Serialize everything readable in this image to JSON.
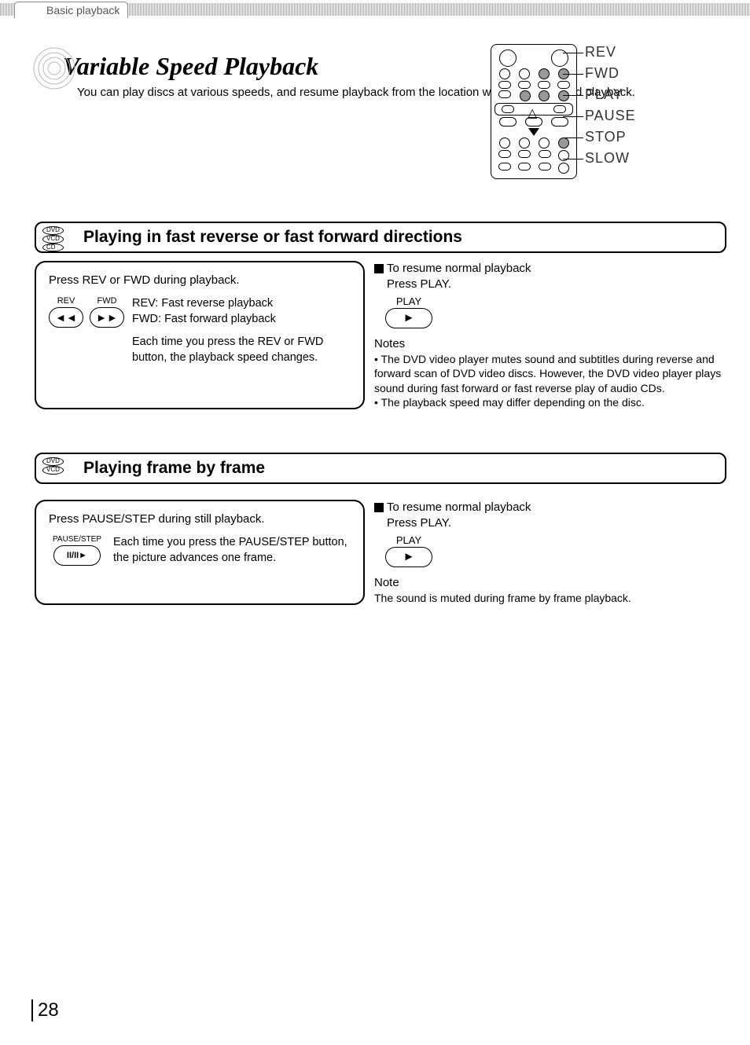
{
  "tab": "Basic playback",
  "title": "Variable Speed Playback",
  "intro": "You can play discs at various speeds, and resume playback from the location where you stopped playback.",
  "remote_labels": [
    "REV",
    "FWD",
    "PLAY",
    "PAUSE",
    "STOP",
    "SLOW"
  ],
  "section1": {
    "discs": [
      "DVD",
      "VCD",
      "CD"
    ],
    "heading": "Playing in fast reverse or fast forward directions",
    "lead": "Press REV or FWD during playback.",
    "btn_rev": "REV",
    "btn_fwd": "FWD",
    "desc1": "REV: Fast reverse playback\nFWD: Fast forward playback",
    "desc2": "Each time you press the REV or FWD button, the playback speed changes.",
    "resume_h": "To resume normal playback",
    "resume_b": "Press PLAY.",
    "play_label": "PLAY",
    "notes_h": "Notes",
    "notes": [
      "The DVD video player mutes sound and subtitles during reverse and forward scan of DVD video discs. However, the DVD video player plays sound during fast forward or fast reverse play of audio CDs.",
      "The playback speed may differ depending on the disc."
    ]
  },
  "section2": {
    "discs": [
      "DVD",
      "VCD"
    ],
    "heading": "Playing frame by frame",
    "lead": "Press PAUSE/STEP during still playback.",
    "btn_pause": "PAUSE/STEP",
    "pause_glyph": "II/II►",
    "desc": "Each time you press the PAUSE/STEP button, the picture advances one frame.",
    "resume_h": "To resume normal playback",
    "resume_b": "Press PLAY.",
    "play_label": "PLAY",
    "note_h": "Note",
    "note": "The sound is muted during frame by frame playback."
  },
  "page": "28"
}
